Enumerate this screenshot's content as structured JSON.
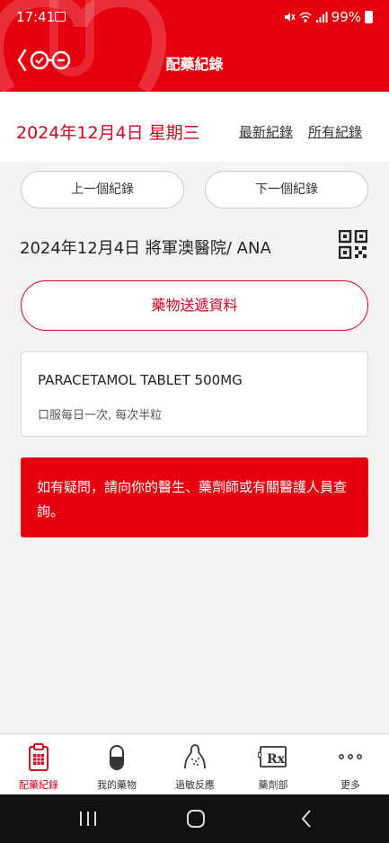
{
  "status_bar": {
    "time": "17:41",
    "battery": "99%"
  },
  "header": {
    "title": "配藥紀錄"
  },
  "date_bar": {
    "date": "2024年12月4日 星期三",
    "latest_link": "最新紀錄",
    "all_link": "所有紀錄"
  },
  "nav_buttons": {
    "prev": "上一個紀錄",
    "next": "下一個紀錄"
  },
  "record": {
    "title": "2024年12月4日 將軍澳醫院/ ANA"
  },
  "delivery_button": "藥物送遞資料",
  "medication": {
    "name": "PARACETAMOL TABLET 500MG",
    "dosage": "口服每日一次, 每次半粒"
  },
  "notice": "如有疑問，請向你的醫生、藥劑師或有關醫護人員查詢。",
  "bottom_nav": {
    "items": [
      {
        "label": "配藥紀錄",
        "icon": "clipboard-icon",
        "active": true
      },
      {
        "label": "我的藥物",
        "icon": "pill-icon",
        "active": false
      },
      {
        "label": "過敏反應",
        "icon": "allergy-icon",
        "active": false
      },
      {
        "label": "藥劑部",
        "icon": "rx-icon",
        "active": false
      },
      {
        "label": "更多",
        "icon": "more-icon",
        "active": false
      }
    ]
  },
  "colors": {
    "brand_red": "#e6000f",
    "text_red": "#d6001c",
    "background": "#f3f3f3"
  }
}
